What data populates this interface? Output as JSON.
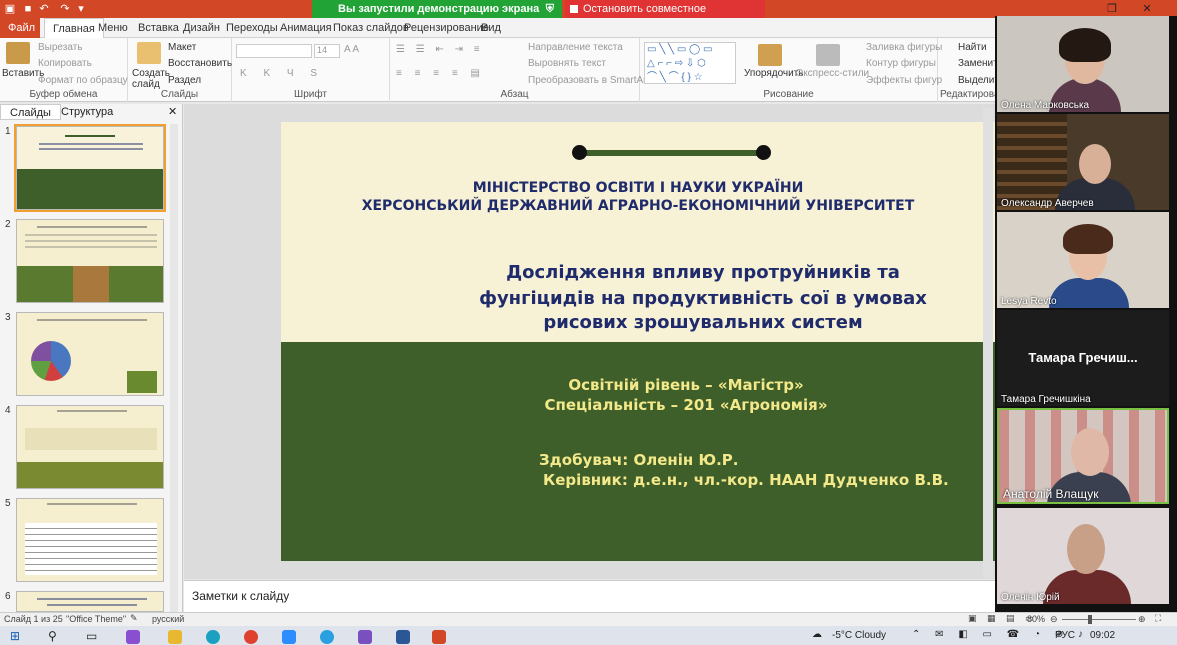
{
  "titlebar": {
    "share_banner": "Вы запустили демонстрацию экрана",
    "stop_banner": "Остановить совместное использование"
  },
  "tabs": [
    "Файл",
    "Главная",
    "Меню",
    "Вставка",
    "Дизайн",
    "Переходы",
    "Анимация",
    "Показ слайдов",
    "Рецензирование",
    "Вид"
  ],
  "ribbon": {
    "clipboard": {
      "label": "Буфер обмена",
      "paste": "Вставить",
      "cut": "Вырезать",
      "copy": "Копировать",
      "format": "Формат по образцу"
    },
    "slides": {
      "label": "Слайды",
      "new_slide": "Создать слайд",
      "layout": "Макет",
      "reset": "Восстановить",
      "section": "Раздел"
    },
    "font": {
      "label": "Шрифт",
      "size": "14"
    },
    "paragraph": {
      "label": "Абзац",
      "text_dir": "Направление текста",
      "align": "Выровнять текст",
      "smartart": "Преобразовать в SmartArt"
    },
    "drawing": {
      "label": "Рисование",
      "arrange": "Упорядочить",
      "styles": "Экспресс-стили",
      "fill": "Заливка фигуры",
      "outline": "Контур фигуры",
      "effects": "Эффекты фигур"
    },
    "editing": {
      "label": "Редактирование",
      "find": "Найти",
      "replace": "Заменить",
      "select": "Выделить"
    }
  },
  "panel": {
    "tab_slides": "Слайды",
    "tab_outline": "Структура",
    "numbers": [
      "1",
      "2",
      "3",
      "4",
      "5",
      "6"
    ]
  },
  "slide": {
    "ministry": "МІНІСТЕРСТВО ОСВІТИ І НАУКИ УКРАЇНИ",
    "university": "ХЕРСОНСЬКИЙ ДЕРЖАВНИЙ АГРАРНО-ЕКОНОМІЧНИЙ УНІВЕРСИТЕТ",
    "title1": "Дослідження впливу протруйників та",
    "title2": "фунгіцидів на продуктивність сої в умовах",
    "title3": "рисових зрошувальних систем",
    "level": "Освітній рівень – «Магістр»",
    "specialty": "Спеціальність – 201 «Агрономія»",
    "student": "Здобувач: Оленін Ю.Р.",
    "supervisor": "Керівник: д.е.н., чл.-кор. НААН Дудченко В.В."
  },
  "notes_placeholder": "Заметки к слайду",
  "status": {
    "slide": "Слайд 1 из 25",
    "theme": "\"Office Theme\"",
    "lang": "русский",
    "zoom": "80%"
  },
  "taskbar": {
    "weather": "-5°C  Cloudy",
    "lang": "РУС",
    "time": "09:02"
  },
  "participants": [
    {
      "name": "Олена Марковська"
    },
    {
      "name": "Олександр Аверчев"
    },
    {
      "name": "Lesya Revto"
    },
    {
      "name": "Тамара Гречишкіна",
      "display": "Тамара  Гречиш..."
    },
    {
      "name": "Анатолій Влащук"
    },
    {
      "name": "Оленін Юрій"
    }
  ],
  "colors": {
    "ppt_orange": "#d24726",
    "slide_green": "#3e5e2a",
    "slide_cream": "#f7f1d6",
    "title_navy": "#1f2b6b",
    "subtitle_yellow": "#f3e98a"
  }
}
